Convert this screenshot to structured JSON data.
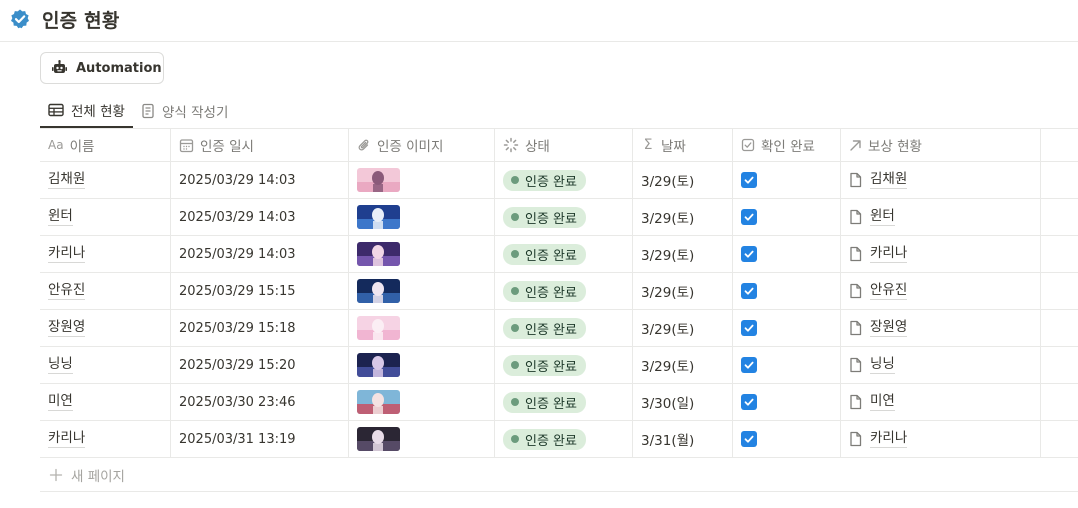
{
  "page": {
    "title": "인증 현황",
    "title_icon": "verified-badge-icon",
    "accent_color": "#3b8ec9"
  },
  "toolbar": {
    "automation_label": "Automation"
  },
  "tabs": [
    {
      "label": "전체 현황",
      "icon": "table-icon",
      "active": true
    },
    {
      "label": "양식 작성기",
      "icon": "form-icon",
      "active": false
    }
  ],
  "columns": [
    {
      "label": "이름",
      "prefix": "Aa",
      "icon": "text-property-icon"
    },
    {
      "label": "인증 일시",
      "icon": "calendar-icon"
    },
    {
      "label": "인증 이미지",
      "icon": "paperclip-icon"
    },
    {
      "label": "상태",
      "icon": "status-icon"
    },
    {
      "label": "날짜",
      "icon": "sigma-icon"
    },
    {
      "label": "확인 완료",
      "icon": "checkbox-icon"
    },
    {
      "label": "보상 현황",
      "icon": "relation-arrow-icon"
    }
  ],
  "rows": [
    {
      "name": "김채원",
      "datetime": "2025/03/29 14:03",
      "status": "인증 완료",
      "date": "3/29(토)",
      "checked": true,
      "reward": "김채원",
      "thumb": "pink"
    },
    {
      "name": "윈터",
      "datetime": "2025/03/29 14:03",
      "status": "인증 완료",
      "date": "3/29(토)",
      "checked": true,
      "reward": "윈터",
      "thumb": "blue"
    },
    {
      "name": "카리나",
      "datetime": "2025/03/29 14:03",
      "status": "인증 완료",
      "date": "3/29(토)",
      "checked": true,
      "reward": "카리나",
      "thumb": "purple"
    },
    {
      "name": "안유진",
      "datetime": "2025/03/29 15:15",
      "status": "인증 완료",
      "date": "3/29(토)",
      "checked": true,
      "reward": "안유진",
      "thumb": "navy"
    },
    {
      "name": "장원영",
      "datetime": "2025/03/29 15:18",
      "status": "인증 완료",
      "date": "3/29(토)",
      "checked": true,
      "reward": "장원영",
      "thumb": "lightpink"
    },
    {
      "name": "닝닝",
      "datetime": "2025/03/29 15:20",
      "status": "인증 완료",
      "date": "3/29(토)",
      "checked": true,
      "reward": "닝닝",
      "thumb": "indigo"
    },
    {
      "name": "미연",
      "datetime": "2025/03/30 23:46",
      "status": "인증 완료",
      "date": "3/30(일)",
      "checked": true,
      "reward": "미연",
      "thumb": "red"
    },
    {
      "name": "카리나",
      "datetime": "2025/03/31 13:19",
      "status": "인증 완료",
      "date": "3/31(월)",
      "checked": true,
      "reward": "카리나",
      "thumb": "dark"
    }
  ],
  "footer": {
    "new_page_label": "새 페이지"
  },
  "colors": {
    "status_bg": "#dbeddb",
    "status_dot": "#6c9b7d",
    "checkbox": "#2383e2"
  }
}
